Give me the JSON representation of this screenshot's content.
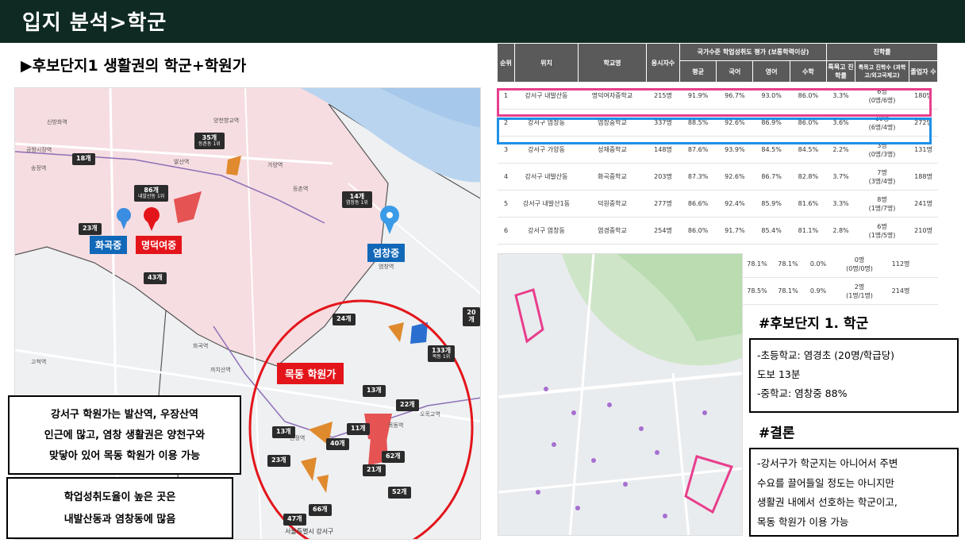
{
  "header": {
    "title": "입지 분석>학군"
  },
  "section": {
    "title": "▶후보단지1 생활권의 학군+학원가"
  },
  "left_map": {
    "school_tags": {
      "hwagok": "화곡중",
      "myeongdeok": "명덕여중",
      "yeomchang": "염창중"
    },
    "hakwon_tag": "목동 학원가",
    "markers": [
      {
        "count": "35개",
        "sub": "등촌동 1위"
      },
      {
        "count": "18개",
        "sub": ""
      },
      {
        "count": "86개",
        "sub": "내발산동 1위"
      },
      {
        "count": "14개",
        "sub": "염창동 1위"
      },
      {
        "count": "23개",
        "sub": ""
      },
      {
        "count": "43개",
        "sub": ""
      },
      {
        "count": "24개",
        "sub": ""
      },
      {
        "count": "133개",
        "sub": "목동 1위"
      },
      {
        "count": "20개",
        "sub": ""
      },
      {
        "count": "13개",
        "sub": ""
      },
      {
        "count": "22개",
        "sub": ""
      },
      {
        "count": "11개",
        "sub": ""
      },
      {
        "count": "13개",
        "sub": ""
      },
      {
        "count": "40개",
        "sub": ""
      },
      {
        "count": "62개",
        "sub": ""
      },
      {
        "count": "23개",
        "sub": ""
      },
      {
        "count": "21개",
        "sub": ""
      },
      {
        "count": "52개",
        "sub": ""
      },
      {
        "count": "66개",
        "sub": ""
      },
      {
        "count": "47개",
        "sub": ""
      }
    ],
    "place_labels": {
      "balsan": "발산역",
      "gongang": "공항시장역",
      "songjeong": "송정역",
      "sinbanghwa": "신방화역",
      "gayang": "가양역",
      "deungchon": "등촌역",
      "yangcheon": "양천향교역",
      "yeomchang": "염창역",
      "hwagok": "화곡역",
      "gochuk": "고척역",
      "kkachisan": "까치산역",
      "sinjeong": "신정역",
      "mokdong": "목동역",
      "omokgyo": "오목교역",
      "seoul_gangseo": "서울특별시 강서구"
    }
  },
  "note1": {
    "lines": [
      "강서구 학원가는 발산역, 우장산역",
      "인근에 많고, 염창 생활권은 양천구와",
      "맞닿아 있어 목동 학원가 이용 가능"
    ]
  },
  "note2": {
    "lines": [
      "학업성취도율이 높은 곳은",
      "내발산동과 염창동에 많음"
    ]
  },
  "table": {
    "header_top": {
      "rank": "순위",
      "location": "위치",
      "school": "학교명",
      "examinees": "응시자수",
      "group1": "국가수준 학업성취도 평가 (보통학력이상)",
      "group2": "진학률"
    },
    "header_sub": {
      "avg": "평균",
      "kor": "국어",
      "eng": "영어",
      "math": "수학",
      "special_rate": "특목고 진학률",
      "special_count": "특목고 진학수 (과학고/외고국제고)",
      "grad": "졸업자 수"
    },
    "rows": [
      {
        "rank": "1",
        "loc": "강서구 내발산동",
        "school": "명덕여자중학교",
        "n": "215명",
        "avg": "91.9%",
        "kor": "96.7%",
        "eng": "93.0%",
        "math": "86.0%",
        "sr": "3.3%",
        "sc": "6명",
        "sc2": "(0명/6명)",
        "grad": "180명"
      },
      {
        "rank": "2",
        "loc": "강서구 염창동",
        "school": "염창중학교",
        "n": "337명",
        "avg": "88.5%",
        "kor": "92.6%",
        "eng": "86.9%",
        "math": "86.0%",
        "sr": "3.6%",
        "sc": "10명",
        "sc2": "(6명/4명)",
        "grad": "272명"
      },
      {
        "rank": "3",
        "loc": "강서구 가양동",
        "school": "성재중학교",
        "n": "148명",
        "avg": "87.6%",
        "kor": "93.9%",
        "eng": "84.5%",
        "math": "84.5%",
        "sr": "2.2%",
        "sc": "3명",
        "sc2": "(0명/3명)",
        "grad": "131명"
      },
      {
        "rank": "4",
        "loc": "강서구 내발산동",
        "school": "화곡중학교",
        "n": "203명",
        "avg": "87.3%",
        "kor": "92.6%",
        "eng": "86.7%",
        "math": "82.8%",
        "sr": "3.7%",
        "sc": "7명",
        "sc2": "(3명/4명)",
        "grad": "188명"
      },
      {
        "rank": "5",
        "loc": "강서구 내발산1동",
        "school": "덕원중학교",
        "n": "277명",
        "avg": "86.6%",
        "kor": "92.4%",
        "eng": "85.9%",
        "math": "81.6%",
        "sr": "3.3%",
        "sc": "8명",
        "sc2": "(1명/7명)",
        "grad": "241명"
      },
      {
        "rank": "6",
        "loc": "강서구 염창동",
        "school": "염경중학교",
        "n": "254명",
        "avg": "86.0%",
        "kor": "91.7%",
        "eng": "85.4%",
        "math": "81.1%",
        "sr": "2.8%",
        "sc": "6명",
        "sc2": "(1명/5명)",
        "grad": "210명"
      }
    ],
    "extra_rows": [
      {
        "eng": "78.1%",
        "math": "78.1%",
        "sr": "0.0%",
        "sc": "0명",
        "sc2": "(0명/0명)",
        "grad": "112명"
      },
      {
        "eng": "78.5%",
        "math": "78.1%",
        "sr": "0.9%",
        "sc": "2명",
        "sc2": "(1명/1명)",
        "grad": "214명"
      }
    ]
  },
  "right": {
    "heading1": "#후보단지 1. 학군",
    "box1": [
      "-초등학교: 염경초 (20명/학급당)",
      "도보 13분",
      "-중학교: 염창중 88%"
    ],
    "heading2": "#결론",
    "box2": [
      "-강서구가 학군지는 아니어서 주변",
      "수요를 끌어들일 정도는 아니지만",
      "생활권 내에서 선호하는 학군이고,",
      "목동 학원가 이용 가능"
    ]
  },
  "colors": {
    "header_bg": "#0e2a23",
    "accent_red": "#e3151b",
    "accent_blue": "#1268b8",
    "highlight_pink": "#e83e8c",
    "highlight_blue": "#1e90e8"
  }
}
